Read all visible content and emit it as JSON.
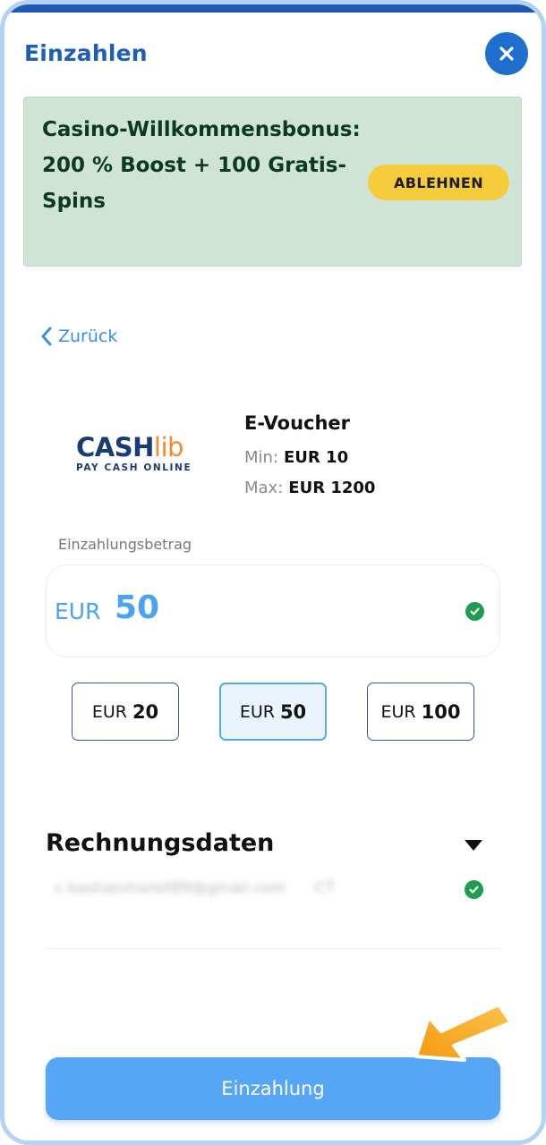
{
  "header": {
    "title": "Einzahlen"
  },
  "promo": {
    "text": "Casino-Willkommensbonus: 200 % Boost + 100 Gratis-Spins",
    "decline_label": "ABLEHNEN"
  },
  "nav": {
    "back_label": "Zurück"
  },
  "method": {
    "logo_main": "CASH",
    "logo_accent": "lib",
    "logo_tagline": "PAY CASH ONLINE",
    "name": "E-Voucher",
    "min_label": "Min:",
    "min_value": "EUR 10",
    "max_label": "Max:",
    "max_value": "EUR 1200"
  },
  "amount": {
    "label": "Einzahlungsbetrag",
    "currency": "EUR",
    "value": "50",
    "presets": [
      {
        "currency": "EUR",
        "amount": "20",
        "selected": false
      },
      {
        "currency": "EUR",
        "amount": "50",
        "selected": true
      },
      {
        "currency": "EUR",
        "amount": "100",
        "selected": false
      }
    ]
  },
  "billing": {
    "title": "Rechnungsdaten",
    "email_masked": "c.bastianmorell89@gmail.com",
    "extra_masked": "CT"
  },
  "submit": {
    "label": "Einzahlung"
  },
  "colors": {
    "brand_blue": "#1e5fb6",
    "accent_blue": "#4aa3f0",
    "promo_bg": "#cfe3d7",
    "decline_yellow": "#f6cb3c",
    "success_green": "#1f9d4f",
    "arrow_orange": "#f7a21c"
  },
  "icons": [
    "close-icon",
    "chevron-left-icon",
    "check-circle-icon",
    "caret-down-icon",
    "arrow-pointer-icon"
  ]
}
